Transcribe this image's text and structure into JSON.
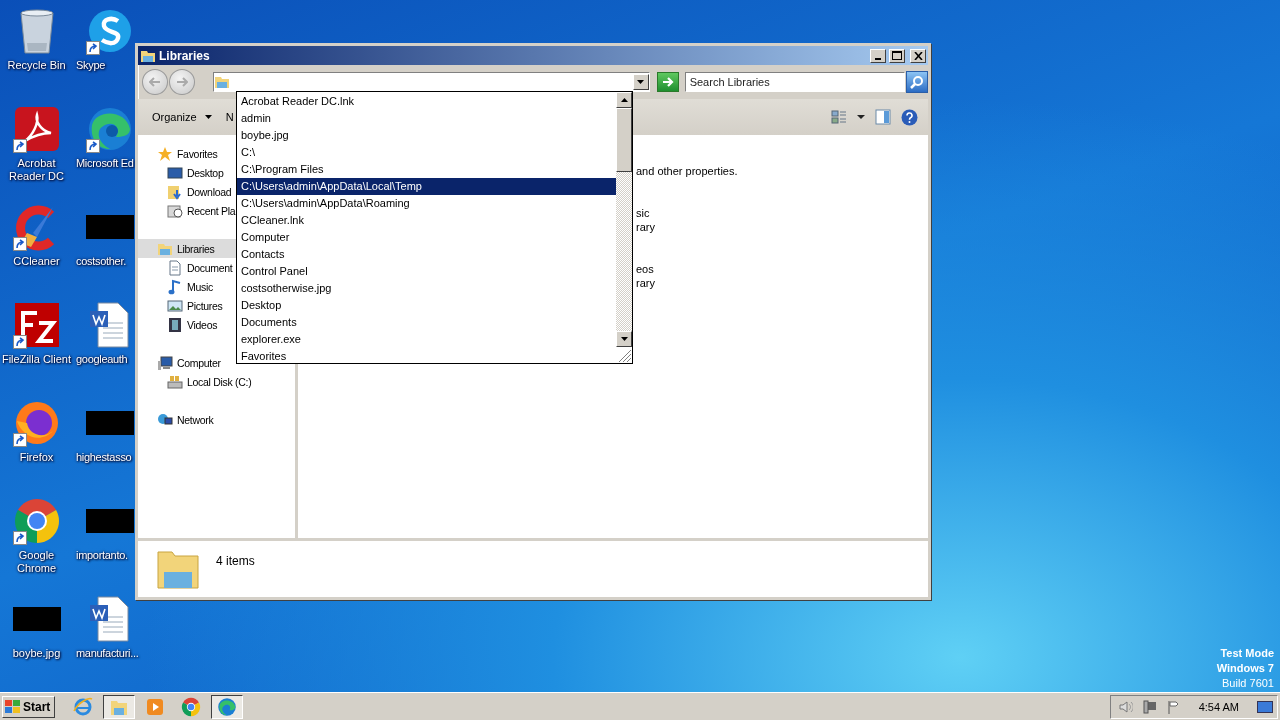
{
  "desktop": {
    "icons": [
      {
        "label": "Recycle Bin",
        "kind": "recycle",
        "shortcut": false
      },
      {
        "label": "Acrobat Reader DC",
        "kind": "acrobat",
        "shortcut": true
      },
      {
        "label": "CCleaner",
        "kind": "ccleaner",
        "shortcut": true
      },
      {
        "label": "FileZilla Client",
        "kind": "filezilla",
        "shortcut": true
      },
      {
        "label": "Firefox",
        "kind": "firefox",
        "shortcut": true
      },
      {
        "label": "Google Chrome",
        "kind": "chrome",
        "shortcut": true
      },
      {
        "label": "boybe.jpg",
        "kind": "thumb",
        "shortcut": false
      },
      {
        "label": "Skype",
        "kind": "skype",
        "shortcut": true
      },
      {
        "label": "Microsoft Ed",
        "kind": "edge",
        "shortcut": true
      },
      {
        "label": "costsother.",
        "kind": "thumb",
        "shortcut": false
      },
      {
        "label": "googleauth",
        "kind": "word",
        "shortcut": false
      },
      {
        "label": "highestasso",
        "kind": "thumb",
        "shortcut": false
      },
      {
        "label": "importanto.",
        "kind": "thumb",
        "shortcut": false
      },
      {
        "label": "manufacturi...",
        "kind": "word",
        "shortcut": false
      }
    ]
  },
  "window": {
    "title": "Libraries",
    "search": {
      "placeholder": "Search Libraries"
    },
    "toolbar": {
      "organize": "Organize",
      "new_partial": "N"
    },
    "nav_pane": [
      {
        "label": "Favorites",
        "kind": "favorites",
        "selected": false,
        "children": [
          {
            "label": "Desktop",
            "kind": "desktop",
            "selected": false
          },
          {
            "label": "Download",
            "kind": "downloads",
            "selected": false
          },
          {
            "label": "Recent Pla",
            "kind": "recent",
            "selected": false
          }
        ]
      },
      {
        "label": "Libraries",
        "kind": "libraries",
        "selected": true,
        "children": [
          {
            "label": "Document",
            "kind": "documents",
            "selected": false
          },
          {
            "label": "Music",
            "kind": "music",
            "selected": false
          },
          {
            "label": "Pictures",
            "kind": "pictures",
            "selected": false
          },
          {
            "label": "Videos",
            "kind": "videos",
            "selected": false
          }
        ]
      },
      {
        "label": "Computer",
        "kind": "computer",
        "selected": false,
        "children": [
          {
            "label": "Local Disk (C:)",
            "kind": "disk",
            "selected": false
          }
        ]
      },
      {
        "label": "Network",
        "kind": "network",
        "selected": false
      }
    ],
    "content": [
      {
        "lines": [
          "and other properties."
        ]
      },
      {
        "lines": [
          "sic",
          "rary"
        ]
      },
      {
        "lines": [
          "eos",
          "rary"
        ]
      }
    ],
    "details": {
      "count": "4 items"
    }
  },
  "address_dropdown": {
    "items": [
      {
        "label": "Acrobat Reader DC.lnk",
        "selected": false
      },
      {
        "label": "admin",
        "selected": false
      },
      {
        "label": "boybe.jpg",
        "selected": false
      },
      {
        "label": "C:\\",
        "selected": false
      },
      {
        "label": "C:\\Program Files",
        "selected": false
      },
      {
        "label": "C:\\Users\\admin\\AppData\\Local\\Temp",
        "selected": true
      },
      {
        "label": "C:\\Users\\admin\\AppData\\Roaming",
        "selected": false
      },
      {
        "label": "CCleaner.lnk",
        "selected": false
      },
      {
        "label": "Computer",
        "selected": false
      },
      {
        "label": "Contacts",
        "selected": false
      },
      {
        "label": "Control Panel",
        "selected": false
      },
      {
        "label": "costsotherwise.jpg",
        "selected": false
      },
      {
        "label": "Desktop",
        "selected": false
      },
      {
        "label": "Documents",
        "selected": false
      },
      {
        "label": "explorer.exe",
        "selected": false
      },
      {
        "label": "Favorites",
        "selected": false
      }
    ]
  },
  "os_notice": [
    {
      "text": "Test Mode",
      "bold": true
    },
    {
      "text": "Windows 7",
      "bold": true
    },
    {
      "text": "Build 7601",
      "bold": false
    }
  ],
  "taskbar": {
    "start": "Start",
    "apps": [
      {
        "kind": "ie",
        "active": false
      },
      {
        "kind": "explorer",
        "active": true
      },
      {
        "kind": "media",
        "active": false
      },
      {
        "kind": "chrome",
        "active": false
      },
      {
        "kind": "edge",
        "active": true
      }
    ],
    "clock": "4:54 AM"
  }
}
